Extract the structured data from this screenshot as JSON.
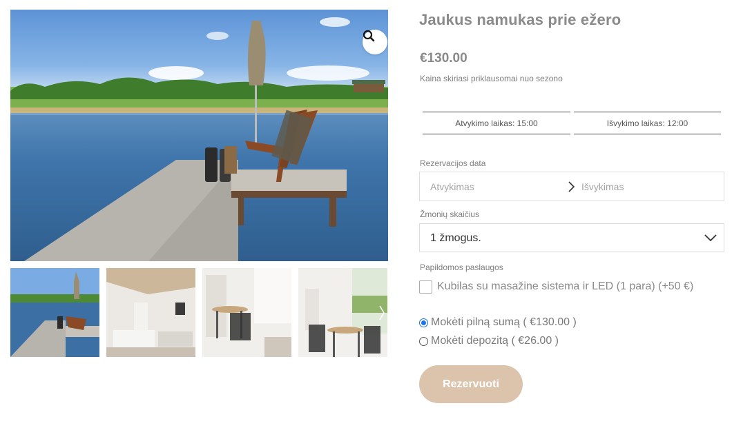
{
  "product": {
    "title": "Jaukus namukas prie ežero",
    "price": "€130.00",
    "price_note": "Kaina skiriasi priklausomai nuo sezono"
  },
  "times": {
    "checkin": "Atvykimo laikas: 15:00",
    "checkout": "Išvykimo laikas: 12:00"
  },
  "booking": {
    "date_label": "Rezervacijos data",
    "arrival_placeholder": "Atvykimas",
    "departure_placeholder": "Išvykimas",
    "people_label": "Žmonių skaičius",
    "people_value": "1 žmogus.",
    "extras_label": "Papildomos paslaugos",
    "extra_option": "Kubilas su masažine sistema ir LED (1 para) (+50 €)",
    "payment_full": "Mokėti pilną sumą ( €130.00 )",
    "payment_deposit": "Mokėti depozitą ( €26.00 )",
    "submit_label": "Rezervuoti"
  },
  "gallery": {
    "main_image": "lake-dock-with-chairs",
    "thumbnails": [
      "lake-dock-with-chairs",
      "cabin-living-room",
      "cabin-dining-area",
      "cabin-dining-window"
    ]
  },
  "icons": {
    "zoom": "magnifier-icon",
    "date_arrow": "chevron-right-icon",
    "select": "chevron-down-icon",
    "gallery_next": "chevron-right-icon"
  },
  "colors": {
    "accent_button": "#dcc4ac",
    "radio_selected": "#1a73e8",
    "text_muted": "#8a8a8a"
  }
}
